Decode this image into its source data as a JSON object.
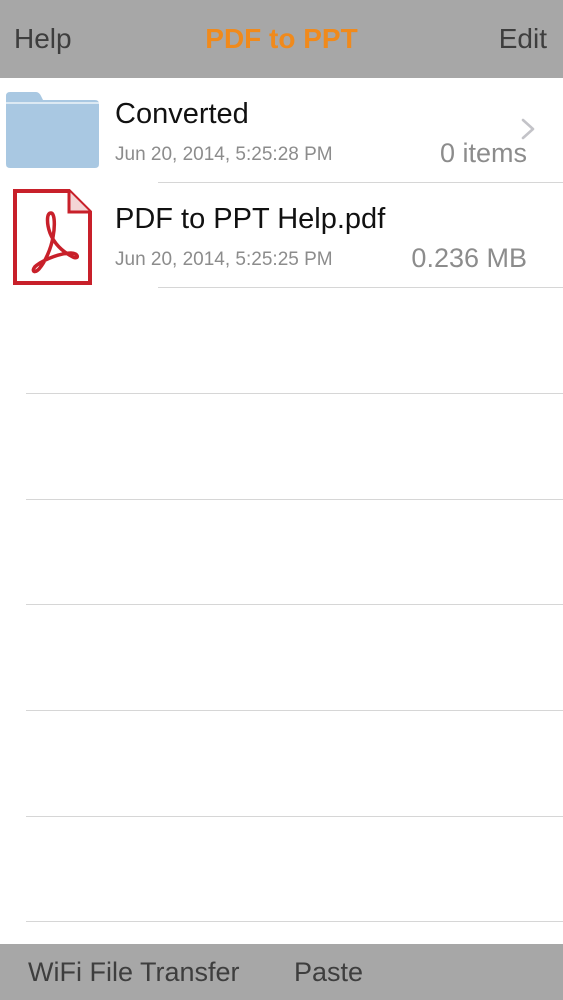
{
  "navbar": {
    "left_label": "Help",
    "title": "PDF to PPT",
    "right_label": "Edit",
    "title_color": "#f08a1c"
  },
  "files": [
    {
      "name": "Converted",
      "date": "Jun 20, 2014, 5:25:28 PM",
      "meta": "0 items",
      "icon": "folder-icon",
      "has_chevron": true
    },
    {
      "name": "PDF to PPT Help.pdf",
      "date": "Jun 20, 2014, 5:25:25 PM",
      "meta": "0.236 MB",
      "icon": "pdf-file-icon",
      "has_chevron": false
    }
  ],
  "toolbar": {
    "wifi_label": "WiFi File Transfer",
    "paste_label": "Paste"
  },
  "colors": {
    "bar_background": "#a7a7a7",
    "folder": "#a9c8e2",
    "pdf_red": "#c8202a"
  }
}
